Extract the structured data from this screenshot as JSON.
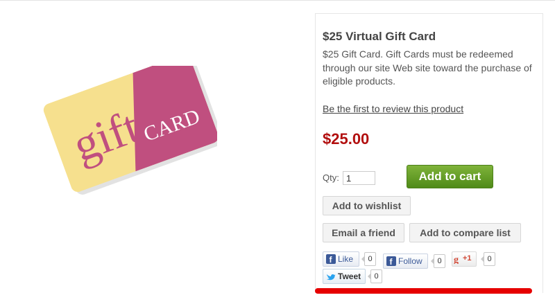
{
  "product": {
    "title": "$25 Virtual Gift Card",
    "description": "$25 Gift Card. Gift Cards must be redeemed through our site Web site toward the purchase of eligible products.",
    "review_link": "Be the first to review this product",
    "price": "$25.00"
  },
  "image": {
    "logo_text_top": "gift",
    "logo_text_bottom": "CARD"
  },
  "cart": {
    "qty_label": "Qty:",
    "qty_value": "1",
    "add_to_cart_label": "Add to cart"
  },
  "actions": {
    "wishlist_label": "Add to wishlist",
    "email_friend_label": "Email a friend",
    "compare_label": "Add to compare list"
  },
  "social": {
    "like_label": "Like",
    "like_count": "0",
    "follow_label": "Follow",
    "follow_count": "0",
    "gplus_label": "+1",
    "gplus_count": "0",
    "tweet_label": "Tweet",
    "tweet_count": "0"
  },
  "colors": {
    "price": "#b20f0f",
    "cart_button": "#5f9a23",
    "gift_card_yellow": "#f6e08e",
    "gift_card_pink": "#c04f7f"
  }
}
